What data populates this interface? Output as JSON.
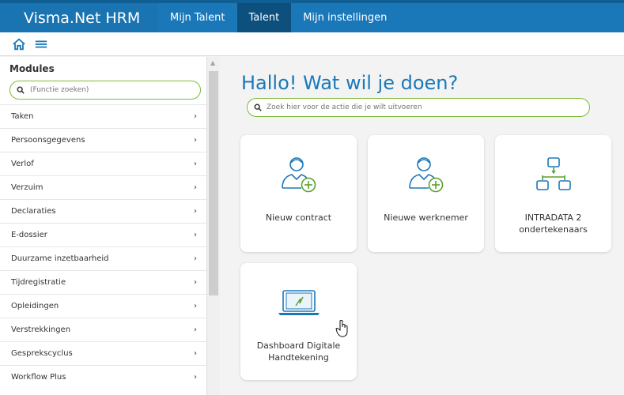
{
  "header": {
    "brand": "Visma.Net HRM",
    "nav": [
      "Mijn Talent",
      "Talent",
      "Mijn instellingen"
    ],
    "active_nav": "Talent"
  },
  "sidebar": {
    "title": "Modules",
    "search_placeholder": "(Functie zoeken)",
    "items": [
      {
        "label": "Taken"
      },
      {
        "label": "Persoonsgegevens"
      },
      {
        "label": "Verlof"
      },
      {
        "label": "Verzuim"
      },
      {
        "label": "Declaraties"
      },
      {
        "label": "E-dossier"
      },
      {
        "label": "Duurzame inzetbaarheid"
      },
      {
        "label": "Tijdregistratie"
      },
      {
        "label": "Opleidingen"
      },
      {
        "label": "Verstrekkingen"
      },
      {
        "label": "Gesprekscyclus"
      },
      {
        "label": "Workflow Plus"
      }
    ]
  },
  "main": {
    "title": "Hallo! Wat wil je doen?",
    "search_placeholder": "Zoek hier voor de actie die je wilt uitvoeren",
    "tiles": [
      {
        "label": "Nieuw contract",
        "icon": "user-add-icon"
      },
      {
        "label": "Nieuwe werknemer",
        "icon": "user-add-icon"
      },
      {
        "label": "INTRADATA 2 ondertekenaars",
        "icon": "hierarchy-icon"
      },
      {
        "label": "Dashboard Digitale Handtekening",
        "icon": "laptop-signature-icon"
      }
    ]
  },
  "colors": {
    "primary": "#1b78b8",
    "active_nav": "#0d4f7d",
    "accent_green": "#7dbb3a"
  }
}
